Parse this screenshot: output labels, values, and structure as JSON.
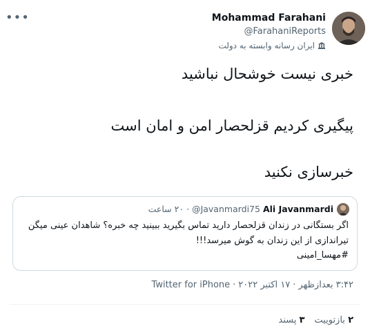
{
  "tweet": {
    "more_icon": "ellipsis-icon",
    "author": {
      "display_name": "Mohammad Farahani",
      "handle": "@FarahaniReports",
      "label": "ایران رسانه وابسته به دولت",
      "label_icon": "government-affiliated-icon"
    },
    "lines": [
      "خبری نیست خوشحال نباشید",
      "پیگیری کردیم قزلحصار امن و امان است",
      "خبرسازی نکنید"
    ],
    "quoted": {
      "display_name": "Ali Javanmardi",
      "handle": "@Javanmardi75",
      "separator": "·",
      "time": "۲۰ ساعت",
      "text_lines": [
        "اگر بستگانی در زندان قزلحصار دارید تماس بگیرید ببینید چه خبره؟ شاهدان عینی میگن",
        "تیراندازی از این زندان به گوش میرسد!!!",
        "#مهسا_امینی"
      ]
    },
    "meta": {
      "time": "۳:۴۲ بعدازظهر",
      "dot1": "·",
      "date": "۱۷ اکتبر ۲۰۲۲",
      "dot2": "·",
      "client": "Twitter for iPhone"
    },
    "stats": {
      "retweets_count": "۲",
      "retweets_label": "بازتوییت",
      "likes_count": "۳",
      "likes_label": "پسند"
    }
  }
}
